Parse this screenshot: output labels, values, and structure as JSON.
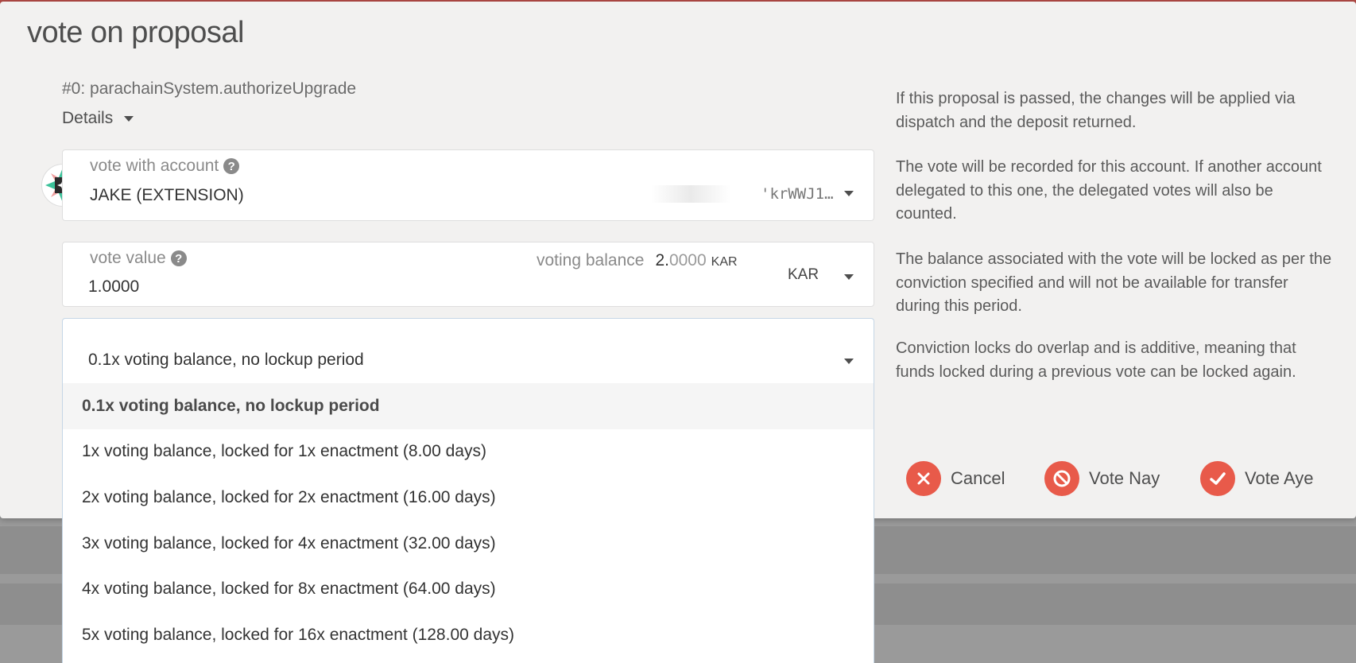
{
  "modal": {
    "title": "vote on proposal",
    "proposal": "#0: parachainSystem.authorizeUpgrade",
    "details_label": "Details"
  },
  "account": {
    "label": "vote with account",
    "name": "JAKE (EXTENSION)",
    "address_tail": "'krWWJ1…"
  },
  "vote_value": {
    "label": "vote value",
    "value": "1.0000",
    "balance_label": "voting balance",
    "balance_int": "2.",
    "balance_dec": "0000",
    "balance_unit": "KAR",
    "unit_select": "KAR"
  },
  "conviction": {
    "selected": "0.1x voting balance, no lockup period",
    "options": [
      "0.1x voting balance, no lockup period",
      "1x voting balance, locked for 1x enactment (8.00 days)",
      "2x voting balance, locked for 2x enactment (16.00 days)",
      "3x voting balance, locked for 4x enactment (32.00 days)",
      "4x voting balance, locked for 8x enactment (64.00 days)",
      "5x voting balance, locked for 16x enactment (128.00 days)"
    ]
  },
  "help": {
    "p1": "If this proposal is passed, the changes will be applied via dispatch and the deposit returned.",
    "p2": "The vote will be recorded for this account. If another account delegated to this one, the delegated votes will also be counted.",
    "p3": "The balance associated with the vote will be locked as per the conviction specified and will not be available for transfer during this period.",
    "p4": "Conviction locks do overlap and is additive, meaning that funds locked during a previous vote can be locked again."
  },
  "actions": {
    "cancel": "Cancel",
    "nay": "Vote Nay",
    "aye": "Vote Aye"
  },
  "colors": {
    "accent": "#e85a4a",
    "topbar": "#b24a45"
  },
  "icons": {
    "help": "question-circle-icon",
    "cancel": "close-icon",
    "nay": "ban-icon",
    "aye": "check-icon",
    "caret": "chevron-down-icon"
  }
}
